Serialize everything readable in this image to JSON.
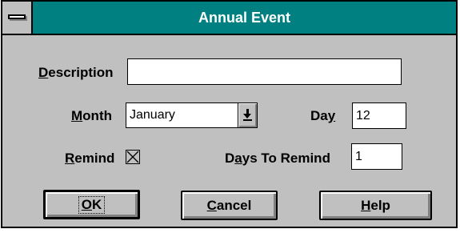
{
  "window": {
    "title": "Annual Event"
  },
  "form": {
    "description": {
      "label_prefix": "",
      "label_mnemonic": "D",
      "label_suffix": "escription",
      "value": ""
    },
    "month": {
      "label_prefix": "",
      "label_mnemonic": "M",
      "label_suffix": "onth",
      "selected": "January"
    },
    "day": {
      "label_prefix": "Da",
      "label_mnemonic": "y",
      "label_suffix": "",
      "value": "12"
    },
    "remind": {
      "label_prefix": "",
      "label_mnemonic": "R",
      "label_suffix": "emind",
      "checked": true
    },
    "days_to_remind": {
      "label_prefix": "D",
      "label_mnemonic": "a",
      "label_suffix": "ys To Remind",
      "value": "1"
    }
  },
  "buttons": {
    "ok": {
      "mnemonic": "O",
      "rest": "K"
    },
    "cancel": {
      "mnemonic": "C",
      "rest": "ancel"
    },
    "help": {
      "mnemonic": "H",
      "rest": "elp"
    }
  },
  "icons": {
    "system_menu": "system-menu-icon",
    "dropdown": "down-arrow-icon"
  },
  "colors": {
    "title_bar": "#008080",
    "dialog_face": "#c0c0c0",
    "title_text": "#ffffff"
  }
}
